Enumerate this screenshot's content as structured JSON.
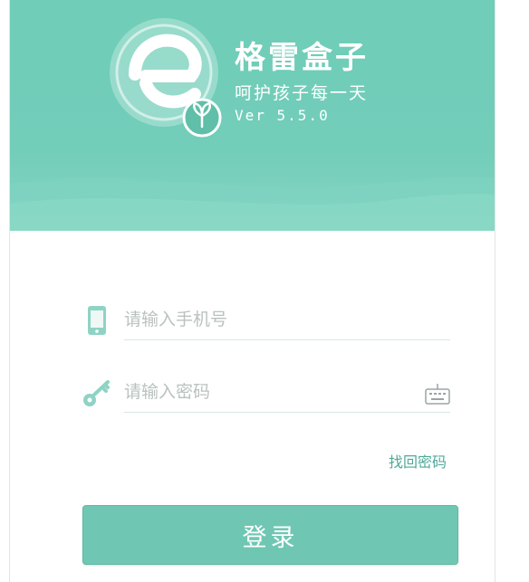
{
  "brand": {
    "title": "格雷盒子",
    "slogan": "呵护孩子每一天",
    "version": "Ver 5.5.0",
    "logo_icon": "e-leaf-logo-icon",
    "colors": {
      "primary": "#72cdb9",
      "button": "#6fc7b3",
      "link": "#4fa99a"
    }
  },
  "login": {
    "phone": {
      "value": "",
      "placeholder": "请输入手机号",
      "icon": "mobile-phone-icon"
    },
    "password": {
      "value": "",
      "placeholder": "请输入密码",
      "icon": "key-icon",
      "keyboard_icon": "keyboard-icon"
    },
    "forgot_label": "找回密码",
    "submit_label": "登录"
  }
}
